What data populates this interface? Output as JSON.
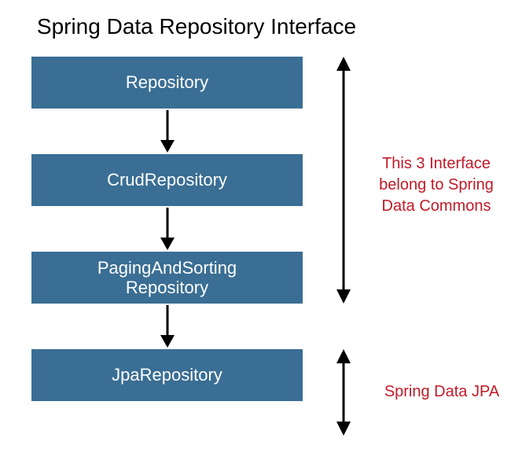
{
  "title": "Spring Data Repository Interface",
  "boxes": {
    "b1": "Repository",
    "b2": "CrudRepository",
    "b3_line1": "PagingAndSorting",
    "b3_line2": "Repository",
    "b4": "JpaRepository"
  },
  "annotations": {
    "group1_line1": "This 3 Interface",
    "group1_line2": "belong to Spring",
    "group1_line3": "Data Commons",
    "group2": "Spring Data JPA"
  }
}
